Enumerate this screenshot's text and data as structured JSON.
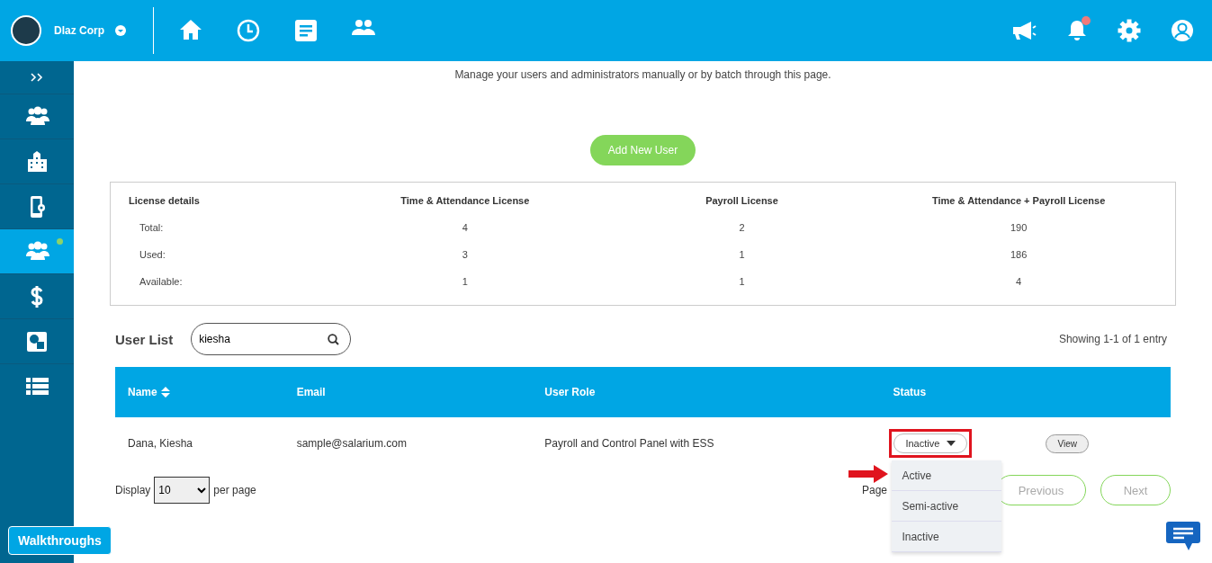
{
  "header": {
    "company": "Dlaz Corp",
    "notification": true
  },
  "sidebar": {
    "items": [
      {
        "selected": false,
        "dot": false
      },
      {
        "selected": false,
        "dot": false
      },
      {
        "selected": false,
        "dot": false
      },
      {
        "selected": true,
        "dot": true
      },
      {
        "selected": false,
        "dot": false
      },
      {
        "selected": false,
        "dot": false
      },
      {
        "selected": false,
        "dot": false
      }
    ]
  },
  "description": "Manage your users and administrators manually or by batch through this page.",
  "add_button": "Add New User",
  "license": {
    "columns": [
      "License details",
      "Time & Attendance License",
      "Payroll License",
      "Time & Attendance + Payroll License"
    ],
    "rows": [
      [
        "Total:",
        "4",
        "2",
        "190"
      ],
      [
        "Used:",
        "3",
        "1",
        "186"
      ],
      [
        "Available:",
        "1",
        "1",
        "4"
      ]
    ]
  },
  "user_list": {
    "title": "User List",
    "search": {
      "value": "kiesha"
    },
    "showing": "Showing 1-1 of 1 entry",
    "columns": [
      "Name",
      "Email",
      "User Role",
      "Status"
    ],
    "rows": [
      {
        "name": "Dana, Kiesha",
        "email": "sample@salarium.com",
        "role": "Payroll and Control Panel with ESS",
        "status": "Inactive",
        "action": "View"
      }
    ],
    "status_options": [
      "Active",
      "Semi-active",
      "Inactive"
    ],
    "display_label": "Display",
    "page_size": "10",
    "per_page": "per page",
    "page_label": "Page",
    "previous": "Previous",
    "next": "Next"
  },
  "walkthroughs": "Walkthroughs"
}
